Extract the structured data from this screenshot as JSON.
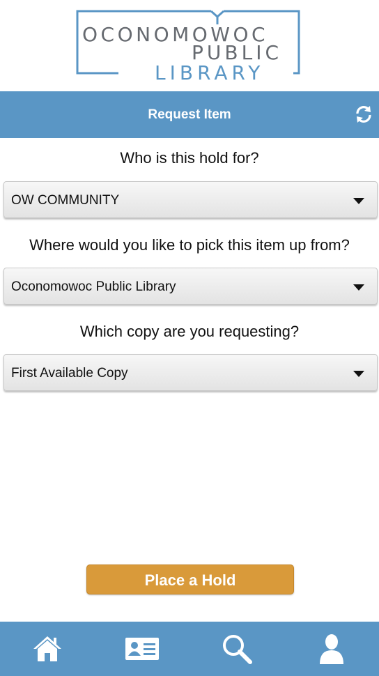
{
  "logo": {
    "line1": "OCONOMOWOC",
    "line2": "PUBLIC",
    "line3": "LIBRARY",
    "dark_color": "#666a70",
    "accent_color": "#5a96c5"
  },
  "header": {
    "title": "Request Item",
    "refresh_icon": "refresh-icon"
  },
  "form": {
    "hold_for_question": "Who is this hold for?",
    "hold_for_value": "OW COMMUNITY",
    "pickup_question": "Where would you like to pick this item up from?",
    "pickup_value": "Oconomowoc Public Library",
    "copy_question": "Which copy are you requesting?",
    "copy_value": "First Available Copy"
  },
  "actions": {
    "place_hold_label": "Place a Hold",
    "button_color": "#d99a3a"
  },
  "bottom_nav": {
    "items": [
      "home-icon",
      "library-card-icon",
      "search-icon",
      "account-icon"
    ],
    "bar_color": "#5a96c5"
  }
}
